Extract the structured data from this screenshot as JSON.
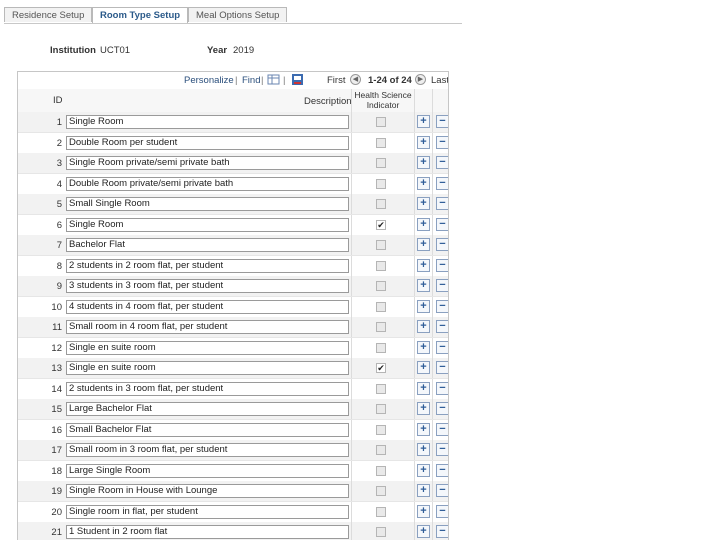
{
  "tabs": [
    {
      "label": "Residence Setup"
    },
    {
      "label": "Room Type Setup"
    },
    {
      "label": "Meal Options Setup"
    }
  ],
  "header": {
    "institution_label": "Institution",
    "institution_value": "UCT01",
    "year_label": "Year",
    "year_value": "2019"
  },
  "grid_nav": {
    "personalize": "Personalize",
    "sep1": "|",
    "find": "Find",
    "sep2": "|",
    "sep3": "|",
    "first": "First",
    "range": "1-24 of 24",
    "last": "Last",
    "view_all_icon": "grid-view-icon",
    "download_icon": "download-icon"
  },
  "columns": {
    "id": "ID",
    "description": "Description",
    "health_line1": "Health Science",
    "health_line2": "Indicator"
  },
  "rows": [
    {
      "id": "1",
      "description": "Single Room",
      "health": false
    },
    {
      "id": "2",
      "description": "Double Room per student",
      "health": false
    },
    {
      "id": "3",
      "description": "Single Room private/semi private bath",
      "health": false
    },
    {
      "id": "4",
      "description": "Double Room private/semi private bath",
      "health": false
    },
    {
      "id": "5",
      "description": "Small Single Room",
      "health": false
    },
    {
      "id": "6",
      "description": "Single Room",
      "health": true
    },
    {
      "id": "7",
      "description": "Bachelor Flat",
      "health": false
    },
    {
      "id": "8",
      "description": "2 students in 2 room flat, per student",
      "health": false
    },
    {
      "id": "9",
      "description": "3 students in 3 room flat, per student",
      "health": false
    },
    {
      "id": "10",
      "description": "4 students in 4 room flat, per student",
      "health": false
    },
    {
      "id": "11",
      "description": "Small room in 4 room flat, per student",
      "health": false
    },
    {
      "id": "12",
      "description": "Single en suite room",
      "health": false
    },
    {
      "id": "13",
      "description": "Single en suite room",
      "health": true
    },
    {
      "id": "14",
      "description": "2 students in 3 room flat, per student",
      "health": false
    },
    {
      "id": "15",
      "description": "Large Bachelor Flat",
      "health": false
    },
    {
      "id": "16",
      "description": "Small Bachelor Flat",
      "health": false
    },
    {
      "id": "17",
      "description": "Small room in 3 room flat, per student",
      "health": false
    },
    {
      "id": "18",
      "description": "Large Single Room",
      "health": false
    },
    {
      "id": "19",
      "description": "Single Room in House with Lounge",
      "health": false
    },
    {
      "id": "20",
      "description": "Single room in flat, per student",
      "health": false
    },
    {
      "id": "21",
      "description": "1 Student in 2 room flat",
      "health": false
    }
  ],
  "buttons": {
    "add": "+",
    "delete": "−",
    "check": "✔"
  },
  "colors": {
    "link": "#2b4f7c",
    "tab_active": "#2b5a8a",
    "row_odd": "#f2f2f2",
    "button": "#2f5d98"
  }
}
